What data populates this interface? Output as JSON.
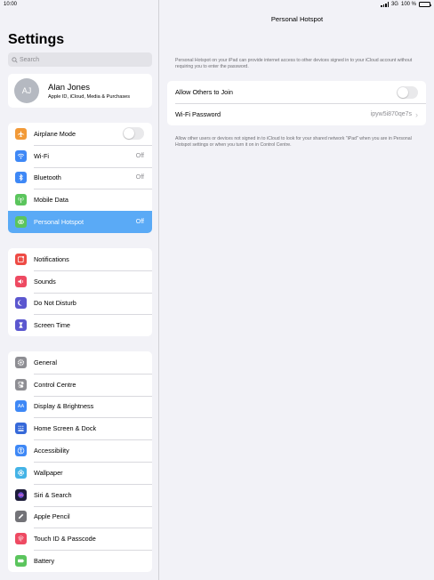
{
  "status_bar": {
    "time": "10:00",
    "network": "3G",
    "battery": "100 %"
  },
  "sidebar": {
    "title": "Settings",
    "search_placeholder": "Search",
    "profile": {
      "initials": "AJ",
      "name": "Alan Jones",
      "subtitle": "Apple ID, iCloud, Media & Purchases"
    },
    "group1": [
      {
        "label": "Airplane Mode",
        "icon": "airplane-icon",
        "color": "#f29a38",
        "toggle": "off"
      },
      {
        "label": "Wi-Fi",
        "icon": "wifi-icon",
        "color": "#3e88f6",
        "value": "Off"
      },
      {
        "label": "Bluetooth",
        "icon": "bluetooth-icon",
        "color": "#3e88f6",
        "value": "Off"
      },
      {
        "label": "Mobile Data",
        "icon": "antenna-icon",
        "color": "#5bc55d"
      },
      {
        "label": "Personal Hotspot",
        "icon": "hotspot-icon",
        "color": "#5bc55d",
        "value": "Off",
        "selected": true
      }
    ],
    "group2": [
      {
        "label": "Notifications",
        "icon": "notifications-icon",
        "color": "#ee4b45"
      },
      {
        "label": "Sounds",
        "icon": "speaker-icon",
        "color": "#ee4a62"
      },
      {
        "label": "Do Not Disturb",
        "icon": "moon-icon",
        "color": "#5b57cf"
      },
      {
        "label": "Screen Time",
        "icon": "hourglass-icon",
        "color": "#5b57cf"
      }
    ],
    "group3": [
      {
        "label": "General",
        "icon": "gear-icon",
        "color": "#8e8e93"
      },
      {
        "label": "Control Centre",
        "icon": "switches-icon",
        "color": "#8e8e93"
      },
      {
        "label": "Display & Brightness",
        "icon": "text-size-icon",
        "color": "#3e88f6",
        "glyph": "AA"
      },
      {
        "label": "Home Screen & Dock",
        "icon": "grid-icon",
        "color": "#3669d9"
      },
      {
        "label": "Accessibility",
        "icon": "accessibility-icon",
        "color": "#3e88f6"
      },
      {
        "label": "Wallpaper",
        "icon": "flower-icon",
        "color": "#44b3e6"
      },
      {
        "label": "Siri & Search",
        "icon": "siri-icon",
        "color": "#1c1c3a"
      },
      {
        "label": "Apple Pencil",
        "icon": "pencil-icon",
        "color": "#737378"
      },
      {
        "label": "Touch ID & Passcode",
        "icon": "fingerprint-icon",
        "color": "#ee4a62"
      },
      {
        "label": "Battery",
        "icon": "battery-icon",
        "color": "#5bc55d"
      }
    ]
  },
  "main": {
    "title": "Personal Hotspot",
    "description_top": "Personal Hotspot on your iPad can provide internet access to other devices signed in to your iCloud account without requiring you to enter the password.",
    "allow_label": "Allow Others to Join",
    "allow_state": "off",
    "password_label": "Wi-Fi Password",
    "password_value": "ipyw5i870qe7s",
    "description_bottom": "Allow other users or devices not signed in to iCloud to look for your shared network \"iPad\" when you are in Personal Hotspot settings or when you turn it on in Control Centre."
  }
}
